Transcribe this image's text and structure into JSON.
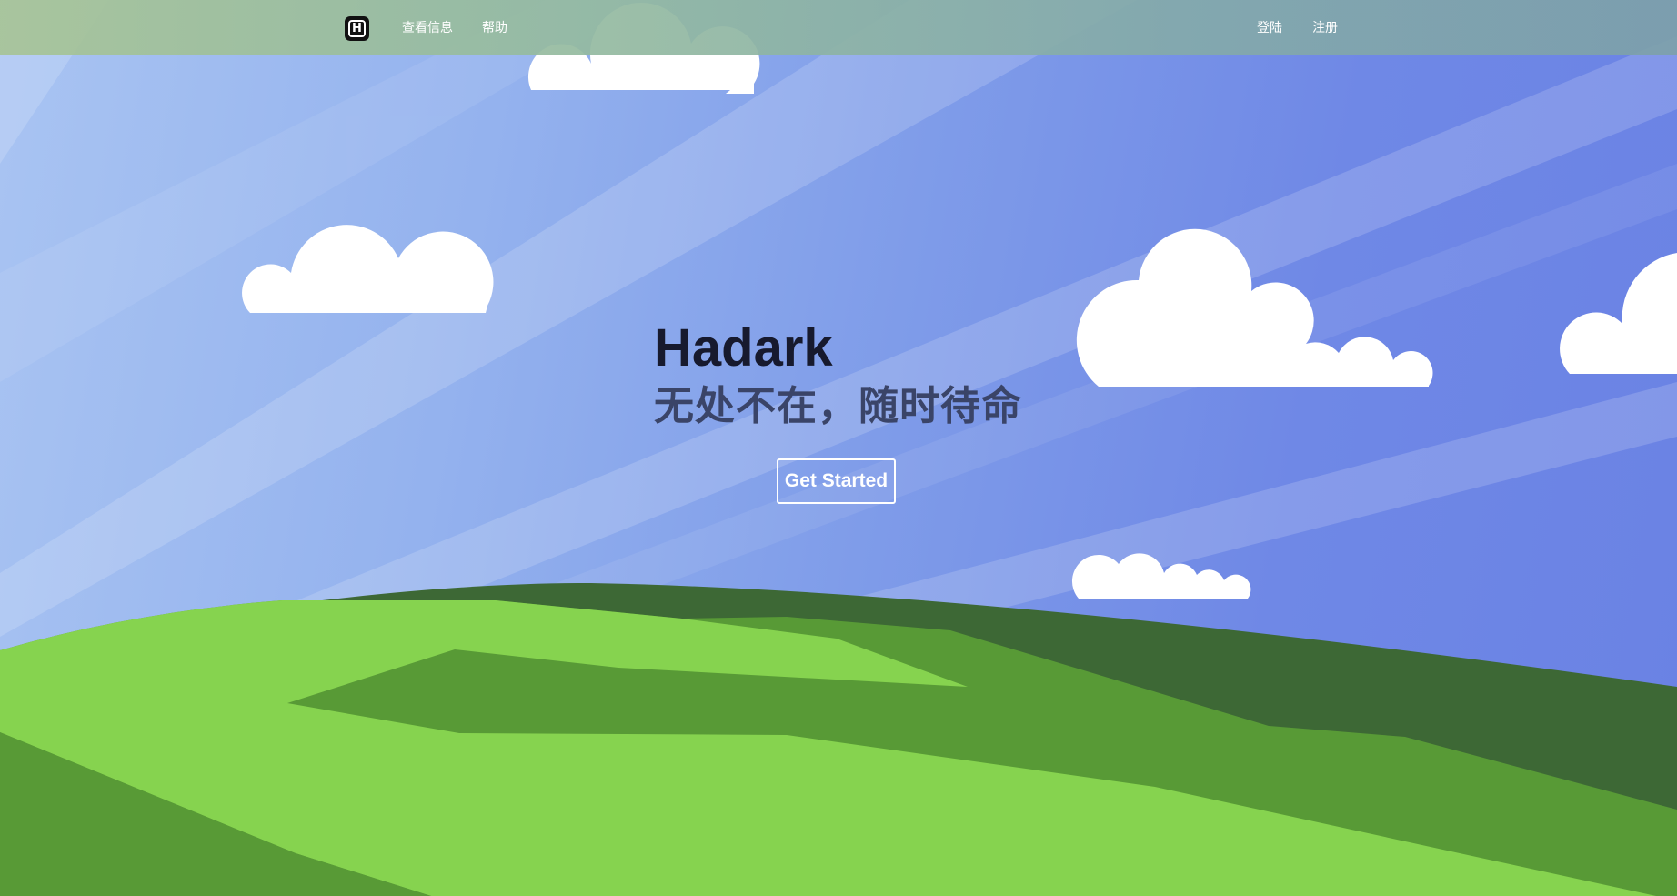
{
  "navbar": {
    "logo_letter": "H",
    "left_links": [
      "查看信息",
      "帮助"
    ],
    "right_links": [
      "登陆",
      "注册"
    ]
  },
  "hero": {
    "title": "Hadark",
    "subtitle": "无处不在，随时待命",
    "cta_label": "Get Started"
  },
  "colors": {
    "sky_light": "#a9c4f2",
    "sky_dark": "#6a82e4",
    "grass_light": "#86d34f",
    "grass_mid": "#589a36",
    "grass_dark": "#3d6835",
    "cloud": "#ffffff",
    "title": "#171a2e"
  },
  "icons": [
    "logo-icon",
    "cloud-icon"
  ]
}
